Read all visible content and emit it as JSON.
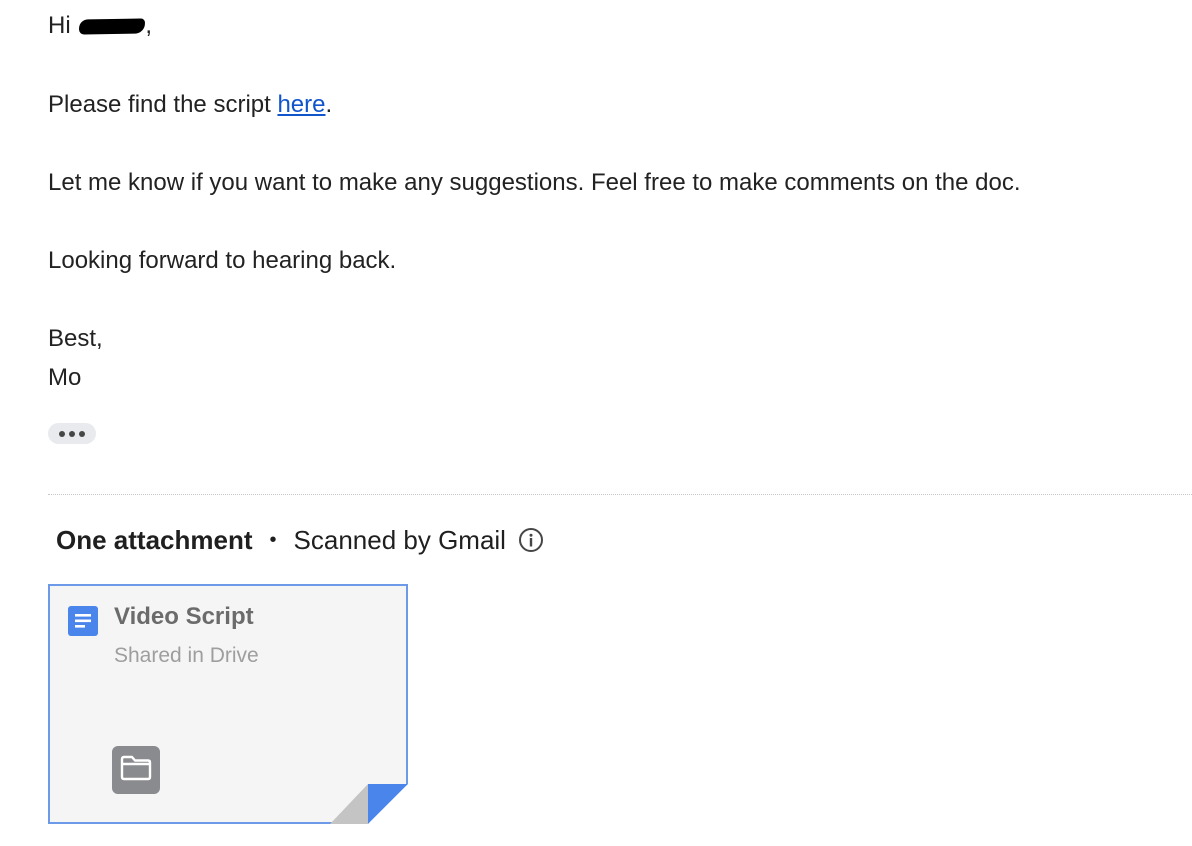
{
  "email": {
    "greeting_prefix": "Hi",
    "greeting_suffix": ",",
    "line2_prefix": "Please find the script ",
    "line2_link": "here",
    "line2_suffix": ".",
    "line3": "Let me know if you want to make any suggestions. Feel free to make comments on the doc.",
    "line4": "Looking forward to hearing back.",
    "signoff": "Best,",
    "signature": "Mo"
  },
  "attachments": {
    "title": "One attachment",
    "bullet": "•",
    "scan_status": "Scanned by Gmail",
    "items": [
      {
        "name": "Video Script",
        "subtitle": "Shared in Drive",
        "type_icon": "google-docs-icon",
        "action_icon": "folder-icon"
      }
    ]
  },
  "colors": {
    "link": "#1155cc",
    "card_border": "#6c9ae8",
    "docs_blue": "#4a85eb",
    "card_bg": "#f5f5f5"
  }
}
